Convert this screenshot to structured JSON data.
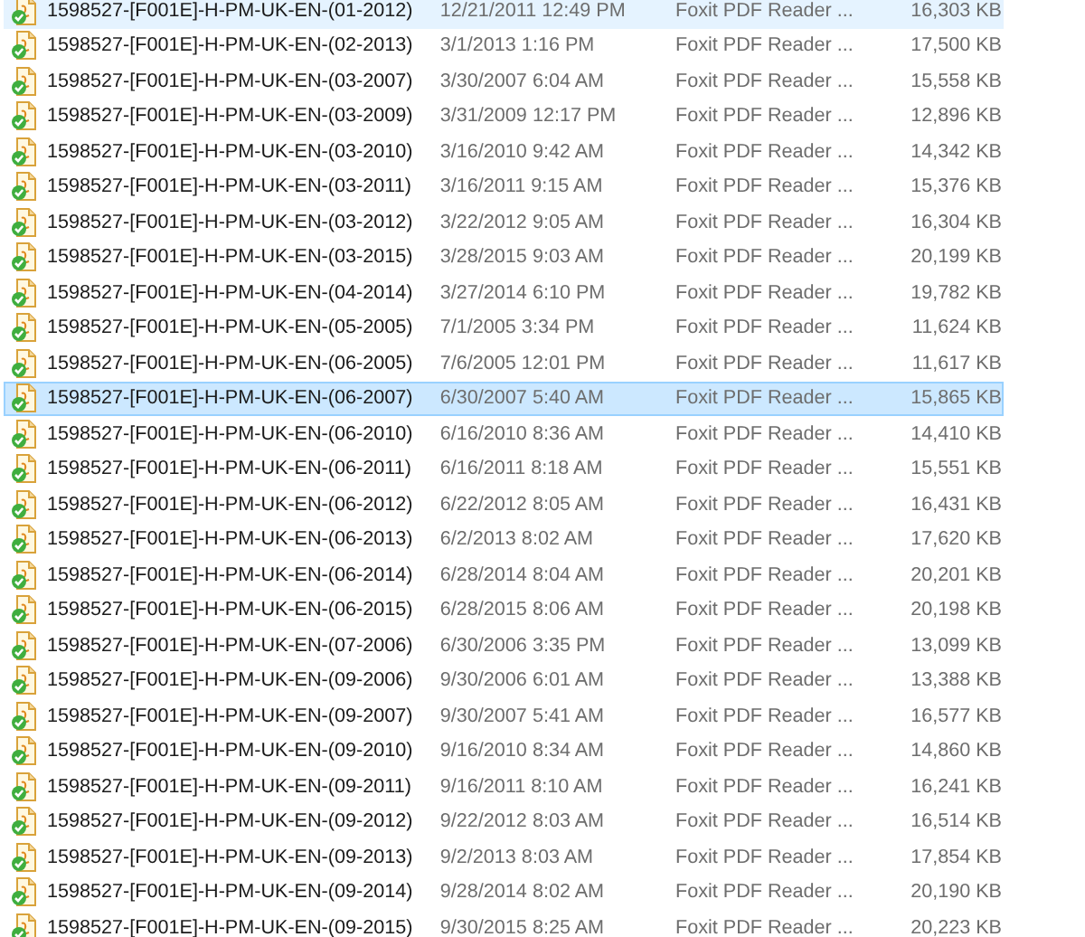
{
  "files": [
    {
      "name": "1598527-[F001E]-H-PM-UK-EN-(01-2012)",
      "date_modified": "12/21/2011 12:49 PM",
      "type": "Foxit PDF Reader ...",
      "size": "16,303 KB",
      "selected": false,
      "hovered": true
    },
    {
      "name": "1598527-[F001E]-H-PM-UK-EN-(02-2013)",
      "date_modified": "3/1/2013 1:16 PM",
      "type": "Foxit PDF Reader ...",
      "size": "17,500 KB",
      "selected": false,
      "hovered": false
    },
    {
      "name": "1598527-[F001E]-H-PM-UK-EN-(03-2007)",
      "date_modified": "3/30/2007 6:04 AM",
      "type": "Foxit PDF Reader ...",
      "size": "15,558 KB",
      "selected": false,
      "hovered": false
    },
    {
      "name": "1598527-[F001E]-H-PM-UK-EN-(03-2009)",
      "date_modified": "3/31/2009 12:17 PM",
      "type": "Foxit PDF Reader ...",
      "size": "12,896 KB",
      "selected": false,
      "hovered": false
    },
    {
      "name": "1598527-[F001E]-H-PM-UK-EN-(03-2010)",
      "date_modified": "3/16/2010 9:42 AM",
      "type": "Foxit PDF Reader ...",
      "size": "14,342 KB",
      "selected": false,
      "hovered": false
    },
    {
      "name": "1598527-[F001E]-H-PM-UK-EN-(03-2011)",
      "date_modified": "3/16/2011 9:15 AM",
      "type": "Foxit PDF Reader ...",
      "size": "15,376 KB",
      "selected": false,
      "hovered": false
    },
    {
      "name": "1598527-[F001E]-H-PM-UK-EN-(03-2012)",
      "date_modified": "3/22/2012 9:05 AM",
      "type": "Foxit PDF Reader ...",
      "size": "16,304 KB",
      "selected": false,
      "hovered": false
    },
    {
      "name": "1598527-[F001E]-H-PM-UK-EN-(03-2015)",
      "date_modified": "3/28/2015 9:03 AM",
      "type": "Foxit PDF Reader ...",
      "size": "20,199 KB",
      "selected": false,
      "hovered": false
    },
    {
      "name": "1598527-[F001E]-H-PM-UK-EN-(04-2014)",
      "date_modified": "3/27/2014 6:10 PM",
      "type": "Foxit PDF Reader ...",
      "size": "19,782 KB",
      "selected": false,
      "hovered": false
    },
    {
      "name": "1598527-[F001E]-H-PM-UK-EN-(05-2005)",
      "date_modified": "7/1/2005 3:34 PM",
      "type": "Foxit PDF Reader ...",
      "size": "11,624 KB",
      "selected": false,
      "hovered": false
    },
    {
      "name": "1598527-[F001E]-H-PM-UK-EN-(06-2005)",
      "date_modified": "7/6/2005 12:01 PM",
      "type": "Foxit PDF Reader ...",
      "size": "11,617 KB",
      "selected": false,
      "hovered": false
    },
    {
      "name": "1598527-[F001E]-H-PM-UK-EN-(06-2007)",
      "date_modified": "6/30/2007 5:40 AM",
      "type": "Foxit PDF Reader ...",
      "size": "15,865 KB",
      "selected": true,
      "hovered": false
    },
    {
      "name": "1598527-[F001E]-H-PM-UK-EN-(06-2010)",
      "date_modified": "6/16/2010 8:36 AM",
      "type": "Foxit PDF Reader ...",
      "size": "14,410 KB",
      "selected": false,
      "hovered": false
    },
    {
      "name": "1598527-[F001E]-H-PM-UK-EN-(06-2011)",
      "date_modified": "6/16/2011 8:18 AM",
      "type": "Foxit PDF Reader ...",
      "size": "15,551 KB",
      "selected": false,
      "hovered": false
    },
    {
      "name": "1598527-[F001E]-H-PM-UK-EN-(06-2012)",
      "date_modified": "6/22/2012 8:05 AM",
      "type": "Foxit PDF Reader ...",
      "size": "16,431 KB",
      "selected": false,
      "hovered": false
    },
    {
      "name": "1598527-[F001E]-H-PM-UK-EN-(06-2013)",
      "date_modified": "6/2/2013 8:02 AM",
      "type": "Foxit PDF Reader ...",
      "size": "17,620 KB",
      "selected": false,
      "hovered": false
    },
    {
      "name": "1598527-[F001E]-H-PM-UK-EN-(06-2014)",
      "date_modified": "6/28/2014 8:04 AM",
      "type": "Foxit PDF Reader ...",
      "size": "20,201 KB",
      "selected": false,
      "hovered": false
    },
    {
      "name": "1598527-[F001E]-H-PM-UK-EN-(06-2015)",
      "date_modified": "6/28/2015 8:06 AM",
      "type": "Foxit PDF Reader ...",
      "size": "20,198 KB",
      "selected": false,
      "hovered": false
    },
    {
      "name": "1598527-[F001E]-H-PM-UK-EN-(07-2006)",
      "date_modified": "6/30/2006 3:35 PM",
      "type": "Foxit PDF Reader ...",
      "size": "13,099 KB",
      "selected": false,
      "hovered": false
    },
    {
      "name": "1598527-[F001E]-H-PM-UK-EN-(09-2006)",
      "date_modified": "9/30/2006 6:01 AM",
      "type": "Foxit PDF Reader ...",
      "size": "13,388 KB",
      "selected": false,
      "hovered": false
    },
    {
      "name": "1598527-[F001E]-H-PM-UK-EN-(09-2007)",
      "date_modified": "9/30/2007 5:41 AM",
      "type": "Foxit PDF Reader ...",
      "size": "16,577 KB",
      "selected": false,
      "hovered": false
    },
    {
      "name": "1598527-[F001E]-H-PM-UK-EN-(09-2010)",
      "date_modified": "9/16/2010 8:34 AM",
      "type": "Foxit PDF Reader ...",
      "size": "14,860 KB",
      "selected": false,
      "hovered": false
    },
    {
      "name": "1598527-[F001E]-H-PM-UK-EN-(09-2011)",
      "date_modified": "9/16/2011 8:10 AM",
      "type": "Foxit PDF Reader ...",
      "size": "16,241 KB",
      "selected": false,
      "hovered": false
    },
    {
      "name": "1598527-[F001E]-H-PM-UK-EN-(09-2012)",
      "date_modified": "9/22/2012 8:03 AM",
      "type": "Foxit PDF Reader ...",
      "size": "16,514 KB",
      "selected": false,
      "hovered": false
    },
    {
      "name": "1598527-[F001E]-H-PM-UK-EN-(09-2013)",
      "date_modified": "9/2/2013 8:03 AM",
      "type": "Foxit PDF Reader ...",
      "size": "17,854 KB",
      "selected": false,
      "hovered": false
    },
    {
      "name": "1598527-[F001E]-H-PM-UK-EN-(09-2014)",
      "date_modified": "9/28/2014 8:02 AM",
      "type": "Foxit PDF Reader ...",
      "size": "20,190 KB",
      "selected": false,
      "hovered": false
    },
    {
      "name": "1598527-[F001E]-H-PM-UK-EN-(09-2015)",
      "date_modified": "9/30/2015 8:25 AM",
      "type": "Foxit PDF Reader ...",
      "size": "20,223 KB",
      "selected": false,
      "hovered": false
    }
  ]
}
